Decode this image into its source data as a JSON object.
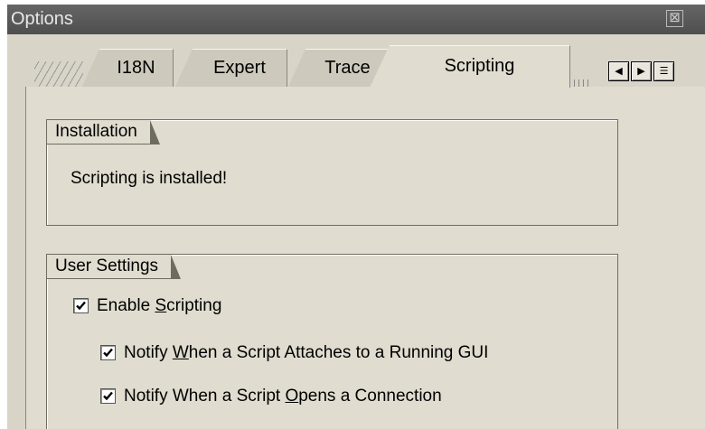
{
  "window": {
    "title": "Options",
    "close_glyph": "⊠"
  },
  "tabs": [
    {
      "label": "I18N",
      "active": false
    },
    {
      "label": "Expert",
      "active": false
    },
    {
      "label": "Trace",
      "active": false
    },
    {
      "label": "Scripting",
      "active": true
    }
  ],
  "tab_nav": {
    "prev_icon": "triangle-left-icon",
    "next_icon": "triangle-right-icon",
    "list_icon": "tab-list-icon",
    "prev_glyph": "◀",
    "next_glyph": "▶",
    "list_glyph": "☰"
  },
  "installation": {
    "title": "Installation",
    "status": "Scripting is installed!"
  },
  "user_settings": {
    "title": "User Settings",
    "enable_scripting": {
      "pre": "Enable ",
      "mnemonic": "S",
      "post": "cripting",
      "checked": true
    },
    "notify_attach": {
      "pre": "Notify ",
      "mnemonic": "W",
      "post": "hen a Script Attaches to a Running GUI",
      "checked": true
    },
    "notify_connection": {
      "pre": "Notify When a Script ",
      "mnemonic": "O",
      "post": "pens a Connection",
      "checked": true
    }
  },
  "colors": {
    "dialog_bg": "#e0dccf",
    "titlebar_bg": "#555555"
  }
}
